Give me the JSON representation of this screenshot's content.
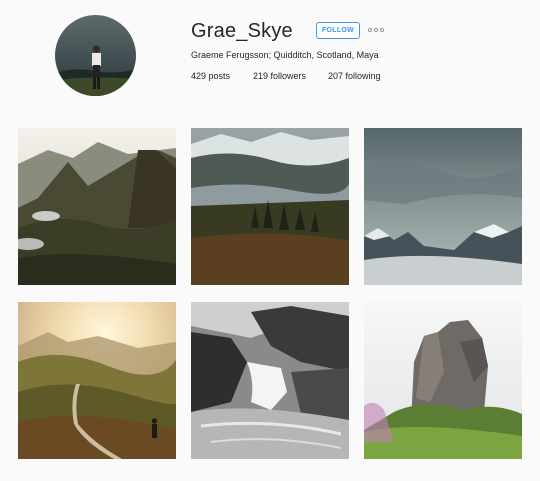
{
  "profile": {
    "username": "Grae_Skye",
    "follow_label": "FOLLOW",
    "bio": "Graeme Ferugsson; Quidditch, Scotland, Maya",
    "stats": {
      "posts_count": "429",
      "posts_label": "posts",
      "followers_count": "219",
      "followers_label": "followers",
      "following_count": "207",
      "following_label": "following"
    },
    "icons": {
      "more": "more-options-icon"
    }
  },
  "colors": {
    "accent": "#3897f0",
    "text": "#262626",
    "background": "#fafafa"
  },
  "posts": [
    {
      "subject": "mountain-valley-lochs"
    },
    {
      "subject": "misty-loch-mountains"
    },
    {
      "subject": "snowy-peaks-clouds"
    },
    {
      "subject": "sunset-road-hiker"
    },
    {
      "subject": "black-white-waterfall"
    },
    {
      "subject": "rock-pillar-sky"
    }
  ]
}
